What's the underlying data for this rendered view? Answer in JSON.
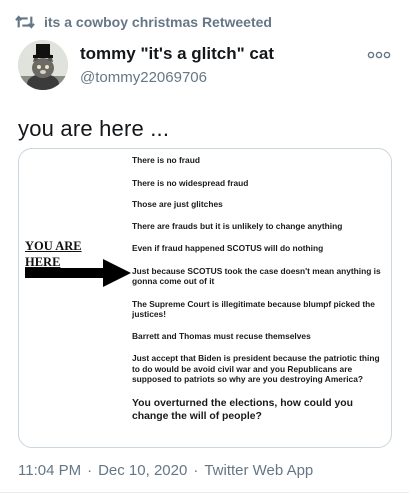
{
  "retweet": {
    "icon": "retweet-icon",
    "text": "its a cowboy christmas Retweeted"
  },
  "author": {
    "display_name": "tommy \"it's a glitch\" cat",
    "handle": "@tommy22069706",
    "avatar_icon": "cat-in-top-hat-avatar",
    "more_icon": "more-options-icon"
  },
  "tweet": {
    "text": "you are here ..."
  },
  "media": {
    "you_are_here": [
      "YOU ARE",
      "HERE"
    ],
    "lines": [
      "There is no fraud",
      "There is no widespread fraud",
      "Those are just glitches",
      "There are frauds but it is unlikely to change anything",
      "Even if fraud happened SCOTUS will do nothing",
      "Just because SCOTUS took the case doesn't mean anything is gonna come out of it",
      "The Supreme Court is illegitimate because blumpf picked the justices!",
      "Barrett and Thomas must recuse themselves",
      "Just accept that Biden is president because the patriotic thing to do would be avoid civil war and you Republicans are supposed to patriots so why are you destroying America?",
      "You overturned the elections, how could you change the will of people?"
    ]
  },
  "meta": {
    "time": "11:04 PM",
    "date": "Dec 10, 2020",
    "source": "Twitter Web App",
    "separator": "·"
  },
  "colors": {
    "secondary_text": "#657786",
    "primary_text": "#14171a",
    "border": "#ccd6dd"
  }
}
